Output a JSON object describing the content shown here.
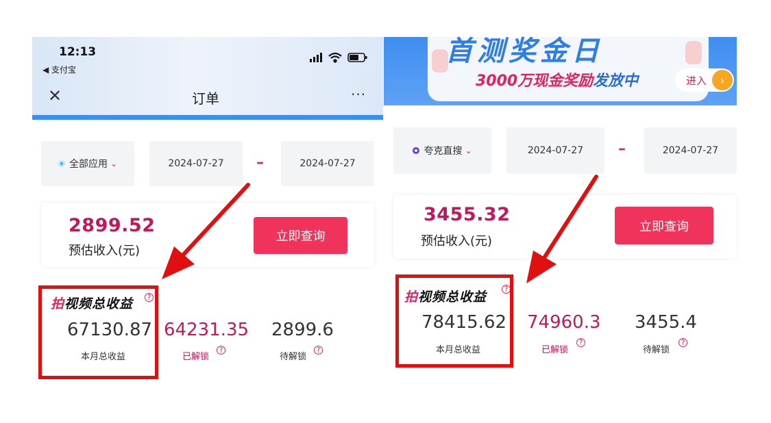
{
  "left": {
    "status": {
      "time": "12:13",
      "back_app": "◀ 支付宝"
    },
    "nav": {
      "close_glyph": "✕",
      "title": "订单",
      "more_glyph": "···"
    },
    "filter": {
      "app_label": "全部应用",
      "caret": "⌄",
      "date_from": "2024-07-27",
      "dash": "–",
      "date_to": "2024-07-27"
    },
    "income": {
      "value": "2899.52",
      "label": "预估收入(元)",
      "query_button": "立即查询"
    },
    "earnings": {
      "title_first": "拍",
      "title_rest": "视频总收益",
      "help": "?",
      "total": {
        "value": "67130.87",
        "label": "本月总收益"
      },
      "unlocked": {
        "value": "64231.35",
        "label": "已解锁"
      },
      "pending": {
        "value": "2899.6",
        "label": "待解锁"
      }
    }
  },
  "right": {
    "banner": {
      "top_text": "首测奖金日",
      "text_pink": "3000万现金奖励",
      "text_blue": "发放中",
      "enter": "进入",
      "enter_arrow": "›"
    },
    "filter": {
      "app_label": "夸克直搜",
      "caret": "⌄",
      "date_from": "2024-07-27",
      "dash": "–",
      "date_to": "2024-07-27"
    },
    "income": {
      "value": "3455.32",
      "label": "预估收入(元)",
      "query_button": "立即查询"
    },
    "earnings": {
      "title_first": "拍",
      "title_rest": "视频总收益",
      "help": "?",
      "total": {
        "value": "78415.62",
        "label": "本月总收益"
      },
      "unlocked": {
        "value": "74960.3",
        "label": "已解锁"
      },
      "pending": {
        "value": "3455.4",
        "label": "待解锁"
      }
    }
  },
  "colors": {
    "accent_pink": "#c2185b",
    "button_red": "#f0335a",
    "highlight_red": "#e01010",
    "banner_blue": "#3f8ef0"
  }
}
